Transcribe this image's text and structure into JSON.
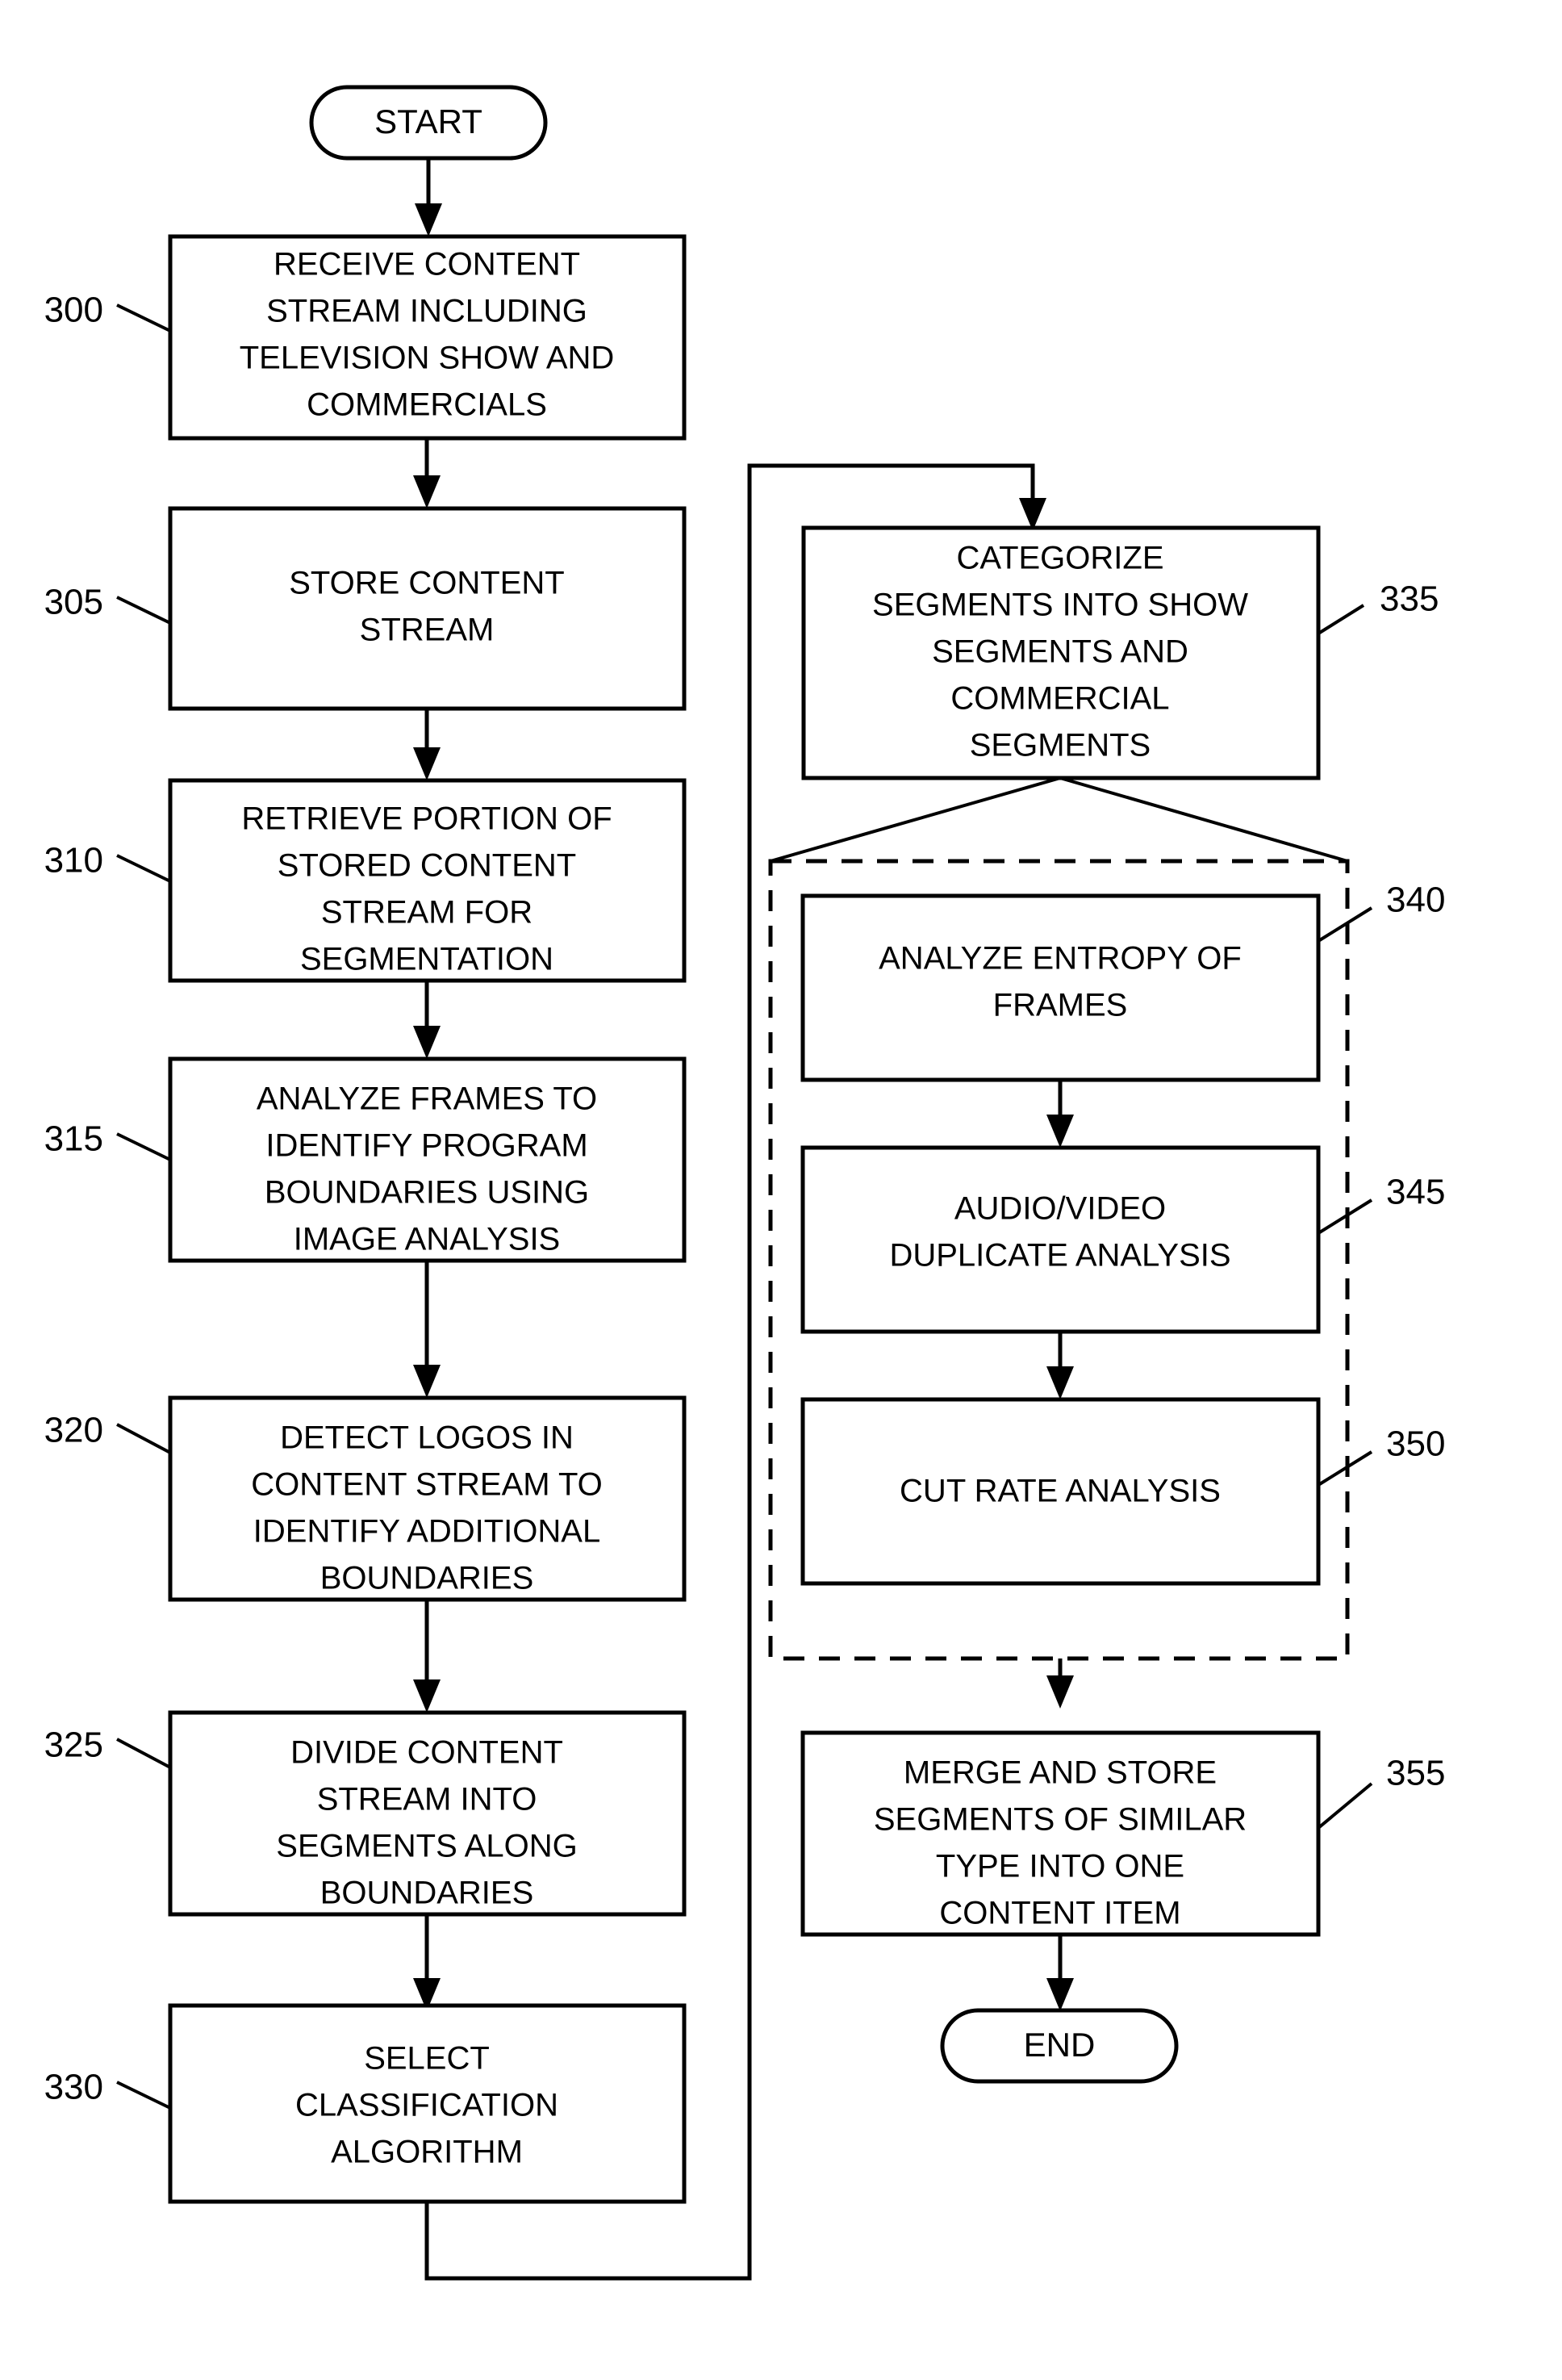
{
  "figure": {
    "type": "flowchart",
    "orientation": "two-column",
    "terminators": {
      "start": "START",
      "end": "END"
    },
    "left_column": [
      {
        "ref": "300",
        "ref_side": "left",
        "lines": [
          "RECEIVE CONTENT",
          "STREAM INCLUDING",
          "TELEVISION SHOW AND",
          "COMMERCIALS"
        ]
      },
      {
        "ref": "305",
        "ref_side": "left",
        "lines": [
          "STORE CONTENT",
          "STREAM"
        ]
      },
      {
        "ref": "310",
        "ref_side": "left",
        "lines": [
          "RETRIEVE PORTION OF",
          "STORED CONTENT",
          "STREAM FOR",
          "SEGMENTATION"
        ]
      },
      {
        "ref": "315",
        "ref_side": "left",
        "lines": [
          "ANALYZE FRAMES TO",
          "IDENTIFY PROGRAM",
          "BOUNDARIES USING",
          "IMAGE ANALYSIS"
        ]
      },
      {
        "ref": "320",
        "ref_side": "left",
        "lines": [
          "DETECT LOGOS IN",
          "CONTENT STREAM TO",
          "IDENTIFY ADDITIONAL",
          "BOUNDARIES"
        ]
      },
      {
        "ref": "325",
        "ref_side": "left",
        "lines": [
          "DIVIDE CONTENT",
          "STREAM INTO",
          "SEGMENTS ALONG",
          "BOUNDARIES"
        ]
      },
      {
        "ref": "330",
        "ref_side": "left",
        "lines": [
          "SELECT",
          "CLASSIFICATION",
          "ALGORITHM"
        ]
      }
    ],
    "right_column": [
      {
        "ref": "335",
        "ref_side": "right",
        "lines": [
          "CATEGORIZE",
          "SEGMENTS INTO SHOW",
          "SEGMENTS AND",
          "COMMERCIAL",
          "SEGMENTS"
        ]
      },
      {
        "ref": "340",
        "ref_side": "right",
        "in_dashed_group": true,
        "lines": [
          "ANALYZE ENTROPY OF",
          "FRAMES"
        ]
      },
      {
        "ref": "345",
        "ref_side": "right",
        "in_dashed_group": true,
        "lines": [
          "AUDIO/VIDEO",
          "DUPLICATE ANALYSIS"
        ]
      },
      {
        "ref": "350",
        "ref_side": "right",
        "in_dashed_group": true,
        "lines": [
          "CUT RATE ANALYSIS"
        ]
      },
      {
        "ref": "355",
        "ref_side": "right",
        "lines": [
          "MERGE AND STORE",
          "SEGMENTS OF SIMILAR",
          "TYPE INTO ONE",
          "CONTENT ITEM"
        ]
      }
    ],
    "colors": {
      "stroke": "#000000",
      "fill": "#ffffff",
      "background": "#ffffff"
    }
  }
}
